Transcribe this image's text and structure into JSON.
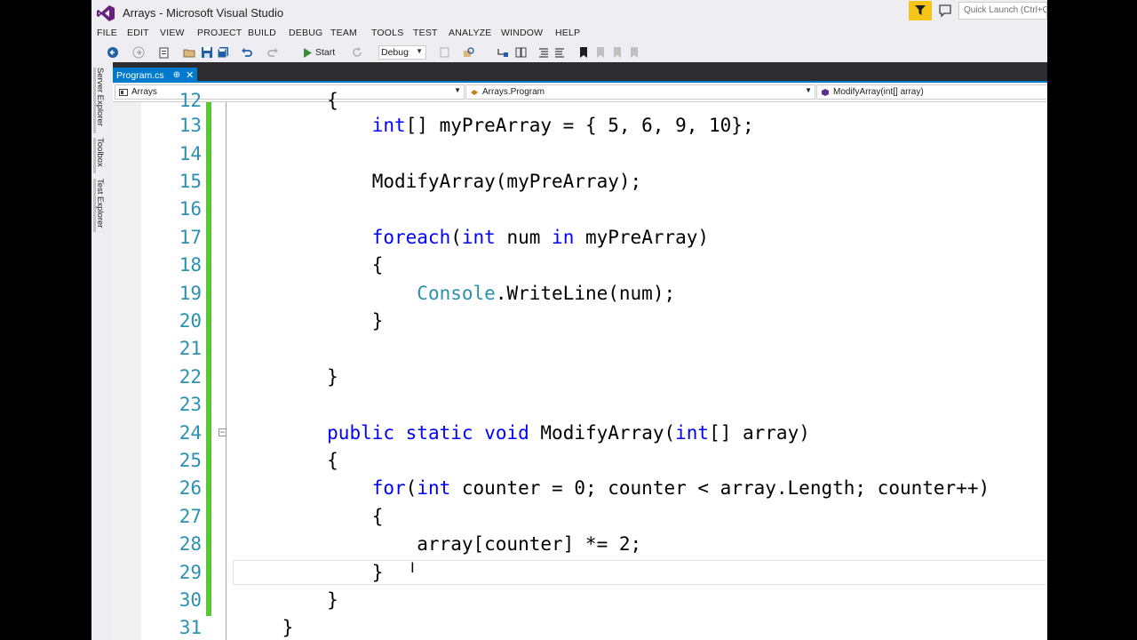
{
  "window": {
    "title": "Arrays - Microsoft Visual Studio"
  },
  "quick_launch": {
    "placeholder": "Quick Launch (Ctrl+Q)"
  },
  "menu": [
    "FILE",
    "EDIT",
    "VIEW",
    "PROJECT",
    "BUILD",
    "DEBUG",
    "TEAM",
    "TOOLS",
    "TEST",
    "ANALYZE",
    "WINDOW",
    "HELP"
  ],
  "toolbar": {
    "start_label": "Start",
    "configuration": "Debug"
  },
  "side_tabs": [
    "Server Explorer",
    "Toolbox",
    "Test Explorer"
  ],
  "doc_tab": {
    "label": "Program.cs"
  },
  "navbar": {
    "project": "Arrays",
    "class": "Arrays.Program",
    "member": "ModifyArray(int[] array)"
  },
  "editor": {
    "lines": [
      {
        "num": "12",
        "tokens": [
          {
            "t": "        {",
            "c": "p"
          }
        ]
      },
      {
        "num": "13",
        "tokens": [
          {
            "t": "            ",
            "c": "p"
          },
          {
            "t": "int",
            "c": "kw"
          },
          {
            "t": "[] myPreArray = { 5, 6, 9, 10};",
            "c": "p"
          }
        ]
      },
      {
        "num": "14",
        "tokens": []
      },
      {
        "num": "15",
        "tokens": [
          {
            "t": "            ModifyArray(myPreArray);",
            "c": "p"
          }
        ]
      },
      {
        "num": "16",
        "tokens": []
      },
      {
        "num": "17",
        "tokens": [
          {
            "t": "            ",
            "c": "p"
          },
          {
            "t": "foreach",
            "c": "kw"
          },
          {
            "t": "(",
            "c": "p"
          },
          {
            "t": "int",
            "c": "kw"
          },
          {
            "t": " num ",
            "c": "p"
          },
          {
            "t": "in",
            "c": "kw"
          },
          {
            "t": " myPreArray)",
            "c": "p"
          }
        ]
      },
      {
        "num": "18",
        "tokens": [
          {
            "t": "            {",
            "c": "p"
          }
        ]
      },
      {
        "num": "19",
        "tokens": [
          {
            "t": "                ",
            "c": "p"
          },
          {
            "t": "Console",
            "c": "ty"
          },
          {
            "t": ".WriteLine(num);",
            "c": "p"
          }
        ]
      },
      {
        "num": "20",
        "tokens": [
          {
            "t": "            }",
            "c": "p"
          }
        ]
      },
      {
        "num": "21",
        "tokens": []
      },
      {
        "num": "22",
        "tokens": [
          {
            "t": "        }",
            "c": "p"
          }
        ]
      },
      {
        "num": "23",
        "tokens": []
      },
      {
        "num": "24",
        "tokens": [
          {
            "t": "        ",
            "c": "p"
          },
          {
            "t": "public",
            "c": "kw"
          },
          {
            "t": " ",
            "c": "p"
          },
          {
            "t": "static",
            "c": "kw"
          },
          {
            "t": " ",
            "c": "p"
          },
          {
            "t": "void",
            "c": "kw"
          },
          {
            "t": " ModifyArray(",
            "c": "p"
          },
          {
            "t": "int",
            "c": "kw"
          },
          {
            "t": "[] array)",
            "c": "p"
          }
        ]
      },
      {
        "num": "25",
        "tokens": [
          {
            "t": "        {",
            "c": "p"
          }
        ]
      },
      {
        "num": "26",
        "tokens": [
          {
            "t": "            ",
            "c": "p"
          },
          {
            "t": "for",
            "c": "kw"
          },
          {
            "t": "(",
            "c": "p"
          },
          {
            "t": "int",
            "c": "kw"
          },
          {
            "t": " counter = 0; counter < array.Length; counter++)",
            "c": "p"
          }
        ]
      },
      {
        "num": "27",
        "tokens": [
          {
            "t": "            {",
            "c": "p"
          }
        ]
      },
      {
        "num": "28",
        "tokens": [
          {
            "t": "                array[counter] *= 2;",
            "c": "p"
          }
        ]
      },
      {
        "num": "29",
        "tokens": [
          {
            "t": "            }",
            "c": "p"
          }
        ]
      },
      {
        "num": "30",
        "tokens": [
          {
            "t": "        }",
            "c": "p"
          }
        ]
      },
      {
        "num": "31",
        "tokens": [
          {
            "t": "    }",
            "c": "p"
          }
        ]
      }
    ]
  },
  "colors": {
    "accent": "#007acc",
    "keyword": "#0000ff",
    "type": "#2b91af",
    "line_number": "#2b91af",
    "change_bar": "#57c734"
  }
}
